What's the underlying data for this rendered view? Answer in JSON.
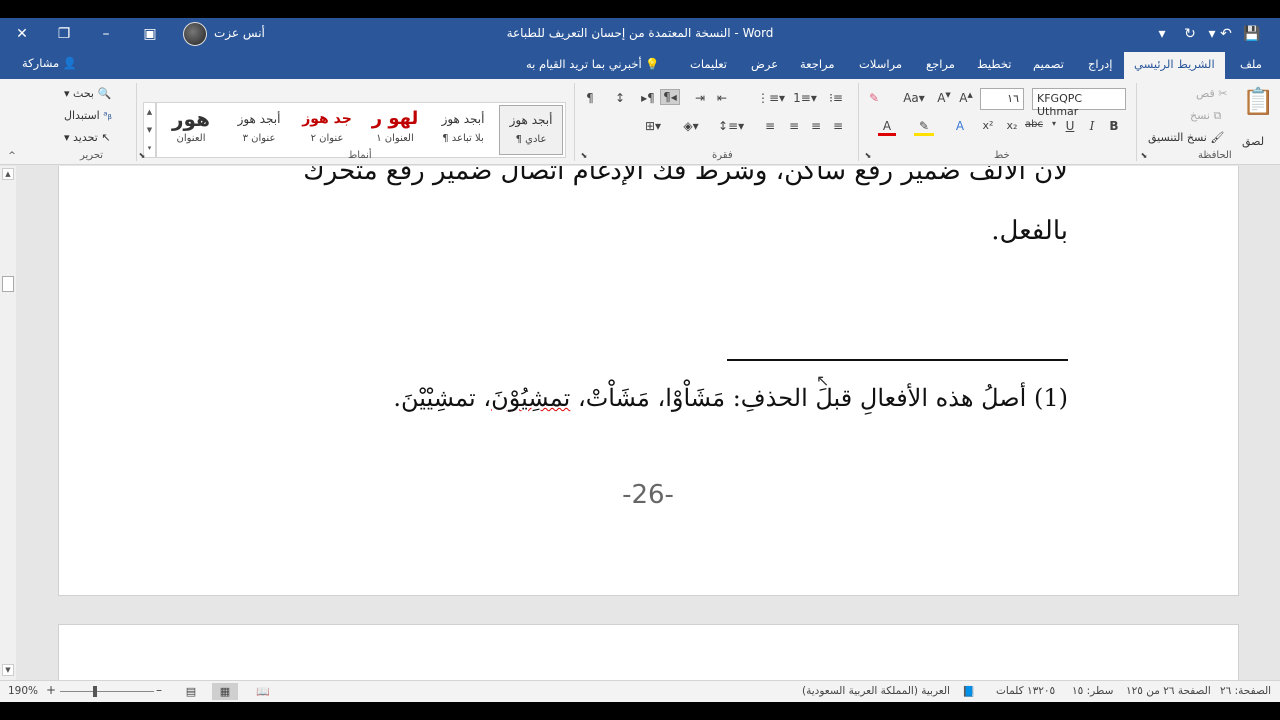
{
  "titlebar": {
    "document_title": "النسخة المعتمدة من إحسان التعريف للطباعة  -  Word",
    "user_name": "أنس عزت",
    "save_icon": "save-icon",
    "undo_icon": "undo-icon",
    "redo_icon": "redo-icon"
  },
  "tabs": {
    "file": "ملف",
    "home": "الشريط الرئيسي",
    "insert": "إدراج",
    "design": "تصميم",
    "layout": "تخطيط",
    "references": "مراجع",
    "mailings": "مراسلات",
    "review": "مراجعة",
    "view": "عرض",
    "help": "تعليمات",
    "tell_me": "أخبرني بما تريد القيام به",
    "share": "مشاركة"
  },
  "clipboard": {
    "paste": "لصق",
    "cut": "قص",
    "copy": "نسخ",
    "format_painter": "نسخ التنسيق",
    "group_label": "الحافظة"
  },
  "font": {
    "font_name": "KFGQPC Uthmar",
    "font_size": "١٦",
    "group_label": "خط"
  },
  "paragraph": {
    "group_label": "فقرة"
  },
  "styles": {
    "group_label": "أنماط",
    "items": [
      {
        "preview": "أبجد هوز",
        "label": "¶ عادي"
      },
      {
        "preview": "أبجد هوز",
        "label": "¶ بلا تباعد"
      },
      {
        "preview": "لهو ر",
        "label": "العنوان ١"
      },
      {
        "preview": "جد هوز",
        "label": "عنوان ٢"
      },
      {
        "preview": "أبجد هوز",
        "label": "عنوان ٣"
      },
      {
        "preview": "هور",
        "label": "العنوان"
      }
    ]
  },
  "editing": {
    "find": "بحث",
    "replace": "استبدال",
    "select": "تحديد",
    "group_label": "تحرير"
  },
  "document": {
    "line_top": "لأن الألف ضمير رفع ساكن، وشرط فك الإدغام اتصال ضمير رفع متحرك",
    "line_second": "بالفعل.",
    "footnote_a": "(1) أصلُ هذه الأفعالِ قبلَ الحذفِ: مَشَاْوْا، مَشَاْتْ، ",
    "footnote_squiggle": "تمشِيُوْنَ",
    "footnote_b": "، تمشِيْيْنَ.",
    "page_number": "-26-"
  },
  "statusbar": {
    "page": "الصفحة: ٢٦",
    "page_of": "الصفحة ٢٦ من ١٢٥",
    "line": "سطر: ١٥",
    "words": "١٣٢٠٥ كلمات",
    "language": "العربية (المملكة العربية السعودية)",
    "zoom": "190%"
  }
}
